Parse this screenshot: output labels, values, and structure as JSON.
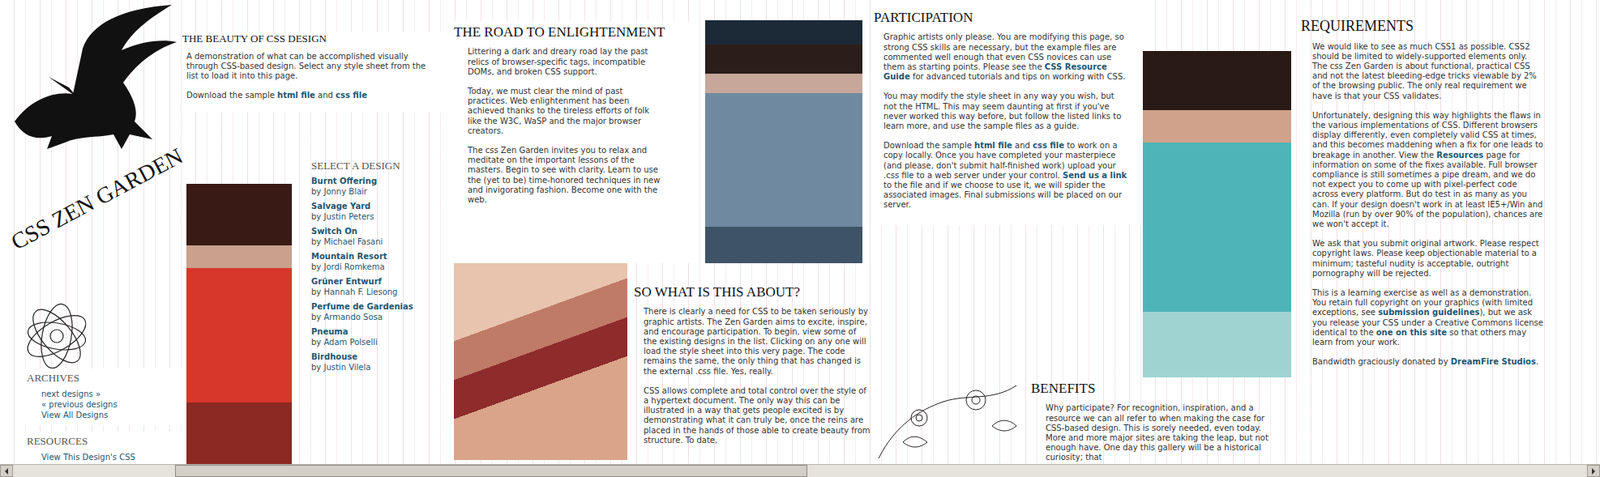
{
  "intro": {
    "title": "THE BEAUTY OF CSS DESIGN",
    "paragraphs": [
      [
        {
          "text": "A demonstration of what can be accomplished visually through CSS-based design. Select any style sheet from the list to load it into this page.",
          "link": false
        }
      ],
      [
        {
          "text": "Download the sample ",
          "link": false
        },
        {
          "text": "html file",
          "link": true
        },
        {
          "text": " and ",
          "link": false
        },
        {
          "text": "css file",
          "link": true
        }
      ]
    ]
  },
  "logo": {
    "title": "CSS ZEN GARDEN"
  },
  "designs": {
    "title": "SELECT A DESIGN",
    "items": [
      {
        "name": "Burnt Offering",
        "by": "by",
        "author": "Jonny Blair"
      },
      {
        "name": "Salvage Yard",
        "by": "by",
        "author": "Justin Peters"
      },
      {
        "name": "Switch On",
        "by": "by",
        "author": "Michael Fasani"
      },
      {
        "name": "Mountain Resort",
        "by": "by",
        "author": "Jordi Romkema"
      },
      {
        "name": "Grüner Entwurf",
        "by": "by",
        "author": "Hannah F. Liesong"
      },
      {
        "name": "Perfume de Gardenias",
        "by": "by",
        "author": "Armando Sosa"
      },
      {
        "name": "Pneuma",
        "by": "by",
        "author": "Adam Polselli"
      },
      {
        "name": "Birdhouse",
        "by": "by",
        "author": "Justin Vilela"
      }
    ]
  },
  "archives": {
    "title": "ARCHIVES",
    "links": [
      "next designs »",
      "« previous designs",
      "View All Designs"
    ]
  },
  "resources": {
    "title": "RESOURCES",
    "links": [
      "View This Design's CSS"
    ]
  },
  "road": {
    "title": "THE ROAD TO ENLIGHTENMENT",
    "paragraphs": [
      [
        {
          "text": "Littering a dark and dreary road lay the past relics of browser-specific tags, incompatible DOMs, and broken CSS support.",
          "link": false
        }
      ],
      [
        {
          "text": "Today, we must clear the mind of past practices. Web enlightenment has been achieved thanks to the tireless efforts of folk like the W3C, WaSP and the major browser creators.",
          "link": false
        }
      ],
      [
        {
          "text": "The css Zen Garden invites you to relax and meditate on the important lessons of the masters. Begin to see with clarity. Learn to use the (yet to be) time-honored techniques in new and invigorating fashion. Become one with the web.",
          "link": false
        }
      ]
    ]
  },
  "about": {
    "title": "SO WHAT IS THIS ABOUT?",
    "paragraphs": [
      [
        {
          "text": "There is clearly a need for CSS to be taken seriously by graphic artists. The Zen Garden aims to excite, inspire, and encourage participation. To begin, view some of the existing designs in the list. Clicking on any one will load the style sheet into this very page. The code remains the same, the only thing that has changed is the external .css file. Yes, really.",
          "link": false
        }
      ],
      [
        {
          "text": "CSS allows complete and total control over the style of a hypertext document. The only way this can be illustrated in a way that gets people excited is by demonstrating what it can truly be, once the reins are placed in the hands of those able to create beauty from structure. To date,",
          "link": false
        }
      ]
    ]
  },
  "participation": {
    "title": "PARTICIPATION",
    "paragraphs": [
      [
        {
          "text": "Graphic artists only please. You are modifying this page, so strong CSS skills are necessary, but the example files are commented well enough that even CSS novices can use them as starting points. Please see the ",
          "link": false
        },
        {
          "text": "CSS Resource Guide",
          "link": true
        },
        {
          "text": " for advanced tutorials and tips on working with CSS.",
          "link": false
        }
      ],
      [
        {
          "text": "You may modify the style sheet in any way you wish, but not the HTML. This may seem daunting at first if you've never worked this way before, but follow the listed links to learn more, and use the sample files as a guide.",
          "link": false
        }
      ],
      [
        {
          "text": "Download the sample ",
          "link": false
        },
        {
          "text": "html file",
          "link": true
        },
        {
          "text": " and ",
          "link": false
        },
        {
          "text": "css file",
          "link": true
        },
        {
          "text": " to work on a copy locally. Once you have completed your masterpiece (and please, don't submit half-finished work) upload your .css file to a web server under your control. ",
          "link": false
        },
        {
          "text": "Send us a link",
          "link": true
        },
        {
          "text": " to the file and if we choose to use it, we will spider the associated images. Final submissions will be placed on our server.",
          "link": false
        }
      ]
    ]
  },
  "benefits": {
    "title": "BENEFITS",
    "paragraphs": [
      [
        {
          "text": "Why participate? For recognition, inspiration, and a resource we can all refer to when making the case for CSS-based design. This is sorely needed, even today. More and more major sites are taking the leap, but not enough have. One day this gallery will be a historical curiosity; that",
          "link": false
        }
      ]
    ]
  },
  "requirements": {
    "title": "REQUIREMENTS",
    "paragraphs": [
      [
        {
          "text": "We would like to see as much CSS1 as possible. CSS2 should be limited to widely-supported elements only. The css Zen Garden is about functional, practical CSS and not the latest bleeding-edge tricks viewable by 2% of the browsing public. The only real requirement we have is that your CSS validates.",
          "link": false
        }
      ],
      [
        {
          "text": "Unfortunately, designing this way highlights the flaws in the various implementations of CSS. Different browsers display differently, even completely valid CSS at times, and this becomes maddening when a fix for one leads to breakage in another. View the ",
          "link": false
        },
        {
          "text": "Resources",
          "link": true
        },
        {
          "text": " page for information on some of the fixes available. Full browser compliance is still sometimes a pipe dream, and we do not expect you to come up with pixel-perfect code across every platform. But do test in as many as you can. If your design doesn't work in at least IE5+/Win and Mozilla (run by over 90% of the population), chances are we won't accept it.",
          "link": false
        }
      ],
      [
        {
          "text": "We ask that you submit original artwork. Please respect copyright laws. Please keep objectionable material to a minimum; tasteful nudity is acceptable, outright pornography will be rejected.",
          "link": false
        }
      ],
      [
        {
          "text": "This is a learning exercise as well as a demonstration. You retain full copyright on your graphics (with limited exceptions, see ",
          "link": false
        },
        {
          "text": "submission guidelines",
          "link": true
        },
        {
          "text": "), but we ask you release your CSS under a Creative Commons license identical to the ",
          "link": false
        },
        {
          "text": "one on this site",
          "link": true
        },
        {
          "text": " so that others may learn from your work.",
          "link": false
        }
      ],
      [
        {
          "text": "Bandwidth graciously donated by ",
          "link": false
        },
        {
          "text": "DreamFire Studios",
          "link": true
        },
        {
          "text": ".",
          "link": false
        }
      ]
    ]
  }
}
